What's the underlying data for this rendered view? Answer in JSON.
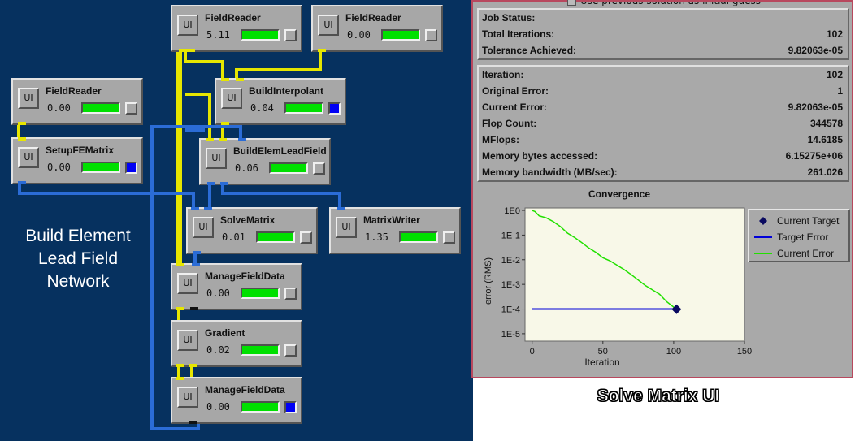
{
  "network": {
    "label_lines": [
      "Build Element",
      "Lead Field",
      "Network"
    ],
    "modules": [
      {
        "id": "fr1",
        "title": "FieldReader",
        "time": "5.11",
        "ui": "UI",
        "led": false
      },
      {
        "id": "fr2",
        "title": "FieldReader",
        "time": "0.00",
        "ui": "UI",
        "led": false
      },
      {
        "id": "fr3",
        "title": "FieldReader",
        "time": "0.00",
        "ui": "UI",
        "led": false
      },
      {
        "id": "bi",
        "title": "BuildInterpolant",
        "time": "0.04",
        "ui": "UI",
        "led": true
      },
      {
        "id": "sfe",
        "title": "SetupFEMatrix",
        "time": "0.00",
        "ui": "UI",
        "led": true
      },
      {
        "id": "belf",
        "title": "BuildElemLeadField",
        "time": "0.06",
        "ui": "UI",
        "led": false
      },
      {
        "id": "sm",
        "title": "SolveMatrix",
        "time": "0.01",
        "ui": "UI",
        "led": false
      },
      {
        "id": "mw",
        "title": "MatrixWriter",
        "time": "1.35",
        "ui": "UI",
        "led": false
      },
      {
        "id": "mfd1",
        "title": "ManageFieldData",
        "time": "0.00",
        "ui": "UI",
        "led": false
      },
      {
        "id": "grad",
        "title": "Gradient",
        "time": "0.02",
        "ui": "UI",
        "led": false
      },
      {
        "id": "mfd2",
        "title": "ManageFieldData",
        "time": "0.00",
        "ui": "UI",
        "led": true
      }
    ],
    "progress": 1.0
  },
  "solve_ui": {
    "top_text": "Use previous solution as initial guess",
    "status_rows": [
      {
        "label": "Job Status:",
        "value": ""
      },
      {
        "label": "Total Iterations:",
        "value": "102"
      },
      {
        "label": "Tolerance Achieved:",
        "value": "9.82063e-05"
      }
    ],
    "detail_rows": [
      {
        "label": "Iteration:",
        "value": "102"
      },
      {
        "label": "Original Error:",
        "value": "1"
      },
      {
        "label": "Current Error:",
        "value": "9.82063e-05"
      },
      {
        "label": "Flop Count:",
        "value": "344578"
      },
      {
        "label": "MFlops:",
        "value": "14.6185"
      },
      {
        "label": "Memory bytes accessed:",
        "value": "6.15275e+06"
      },
      {
        "label": "Memory bandwidth (MB/sec):",
        "value": "261.026"
      }
    ],
    "caption": "Solve Matrix UI"
  },
  "chart_data": {
    "type": "line",
    "title": "Convergence",
    "xlabel": "Iteration",
    "ylabel": "error (RMS)",
    "xlim": [
      -5,
      150
    ],
    "ylim_log10": [
      -5.3,
      0.1
    ],
    "x_ticks": [
      0,
      50,
      100,
      150
    ],
    "y_tick_labels": [
      "1E0",
      "1E-1",
      "1E-2",
      "1E-3",
      "1E-4",
      "1E-5"
    ],
    "y_tick_exponents": [
      0,
      -1,
      -2,
      -3,
      -4,
      -5
    ],
    "legend": [
      "Current Target",
      "Target Error",
      "Current Error"
    ],
    "series": [
      {
        "name": "Current Error",
        "color": "#22e000",
        "x": [
          0,
          2,
          5,
          10,
          15,
          20,
          25,
          30,
          35,
          40,
          45,
          50,
          55,
          60,
          65,
          70,
          75,
          80,
          85,
          90,
          95,
          100,
          102
        ],
        "y": [
          1,
          0.9,
          0.6,
          0.5,
          0.35,
          0.22,
          0.12,
          0.08,
          0.05,
          0.03,
          0.02,
          0.012,
          0.009,
          0.006,
          0.004,
          0.0025,
          0.0015,
          0.0009,
          0.0006,
          0.0004,
          0.0002,
          0.00012,
          9.82e-05
        ]
      },
      {
        "name": "Target Error",
        "color": "#0000d8",
        "x": [
          0,
          102
        ],
        "y": [
          0.0001,
          0.0001
        ]
      },
      {
        "name": "Current Target",
        "color": "#0a0a60",
        "x": [
          102
        ],
        "y": [
          9.82e-05
        ]
      }
    ],
    "grid": false,
    "legend_position": "right"
  }
}
